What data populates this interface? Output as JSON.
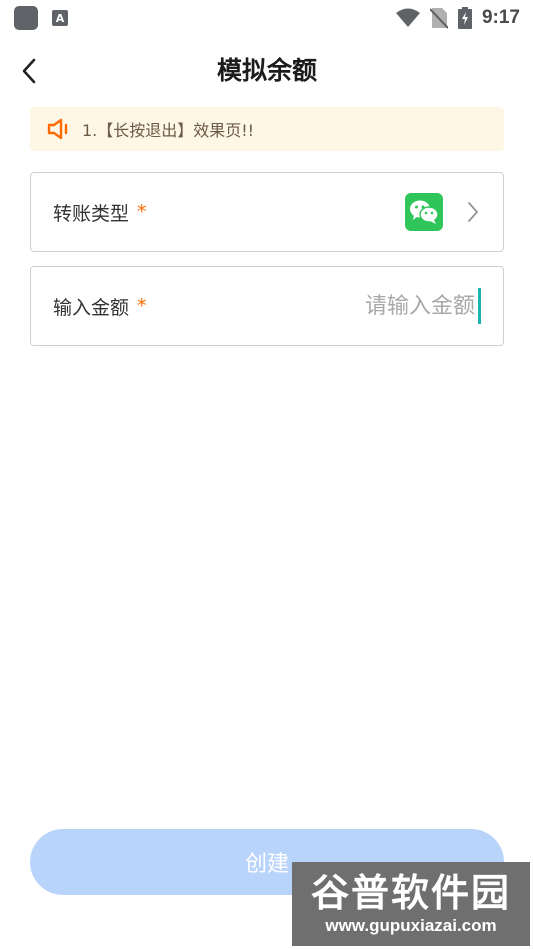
{
  "status_bar": {
    "a_label": "A",
    "time": "9:17"
  },
  "header": {
    "title": "模拟余额"
  },
  "notice": {
    "text": "1.【长按退出】效果页!!"
  },
  "form": {
    "transfer_type": {
      "label": "转账类型",
      "required_mark": "*",
      "selected_icon": "wechat-icon"
    },
    "amount": {
      "label": "输入金额",
      "required_mark": "*",
      "placeholder": "请输入金额",
      "value": ""
    }
  },
  "create_button": {
    "label": "创建"
  },
  "watermark": {
    "title": "谷普软件园",
    "url": "www.gupuxiazai.com"
  },
  "colors": {
    "accent_orange": "#ff6a00",
    "notice_bg": "#fff7e6",
    "wechat_green": "#2fc55a",
    "button_bg": "#b9d4fb",
    "caret": "#1ab3b0"
  }
}
